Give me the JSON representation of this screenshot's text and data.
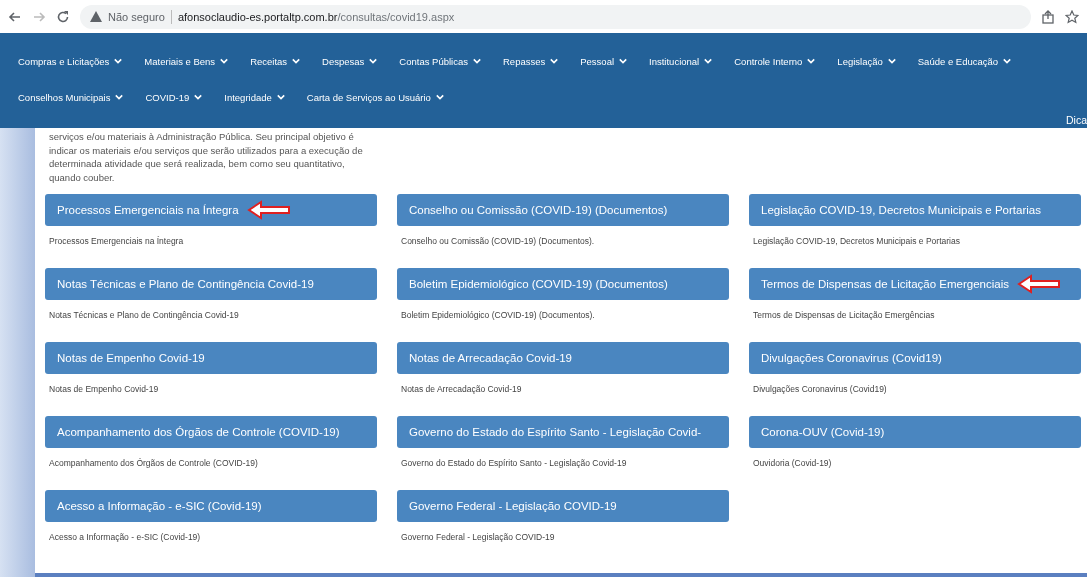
{
  "browser": {
    "security": "Não seguro",
    "url_host": "afonsoclaudio-es.portaltp.com.br",
    "url_path": "/consultas/covid19.aspx"
  },
  "nav": {
    "rows": [
      [
        "Compras e Licitações",
        "Materiais e Bens",
        "Receitas",
        "Despesas",
        "Contas Públicas",
        "Repasses",
        "Pessoal",
        "Institucional",
        "Controle Interno",
        "Legislação",
        "Saúde e Educação"
      ],
      [
        "Conselhos Municipais",
        "COVID-19",
        "Integridade",
        "Carta de Serviços ao Usuário"
      ]
    ],
    "corner_link": "Dica"
  },
  "intro": "serviços e/ou materiais à Administração Pública. Seu principal objetivo é indicar os materiais e/ou serviços que serão utilizados para a execução de determinada atividade que será realizada, bem como seu quantitativo, quando couber.",
  "cards": [
    {
      "title": "Processos Emergenciais na Íntegra",
      "description": "Processos Emergenciais na Íntegra",
      "arrow": true
    },
    {
      "title": "Conselho ou Comissão (COVID-19) (Documentos)",
      "description": "Conselho ou Comissão (COVID-19) (Documentos).",
      "arrow": false
    },
    {
      "title": "Legislação COVID-19, Decretos Municipais e Portarias",
      "description": "Legislação COVID-19, Decretos Municipais e Portarias",
      "arrow": false
    },
    {
      "title": "Notas Técnicas e Plano de Contingência Covid-19",
      "description": "Notas Técnicas e Plano de Contingência Covid-19",
      "arrow": false
    },
    {
      "title": "Boletim Epidemiológico (COVID-19) (Documentos)",
      "description": "Boletim Epidemiológico (COVID-19) (Documentos).",
      "arrow": false
    },
    {
      "title": "Termos de Dispensas de Licitação Emergenciais",
      "description": "Termos de Dispensas de Licitação Emergências",
      "arrow": true
    },
    {
      "title": "Notas de Empenho Covid-19",
      "description": "Notas de Empenho Covid-19",
      "arrow": false
    },
    {
      "title": "Notas de Arrecadação Covid-19",
      "description": "Notas de Arrecadação Covid-19",
      "arrow": false
    },
    {
      "title": "Divulgações Coronavirus (Covid19)",
      "description": "Divulgações Coronavirus (Covid19)",
      "arrow": false
    },
    {
      "title": "Acompanhamento dos Órgãos de Controle (COVID-19)",
      "description": "Acompanhamento dos Órgãos de Controle (COVID-19)",
      "arrow": false
    },
    {
      "title": "Governo do Estado do Espírito Santo - Legislação Covid-",
      "description": "Governo do Estado do Espírito Santo - Legislação Covid-19",
      "arrow": false
    },
    {
      "title": "Corona-OUV (Covid-19)",
      "description": "Ouvidoria (Covid-19)",
      "arrow": false
    },
    {
      "title": "Acesso a Informação - e-SIC (Covid-19)",
      "description": "Acesso a Informação - e-SIC (Covid-19)",
      "arrow": false
    },
    {
      "title": "Governo Federal - Legislação COVID-19",
      "description": "Governo Federal - Legislação COVID-19",
      "arrow": false
    }
  ]
}
